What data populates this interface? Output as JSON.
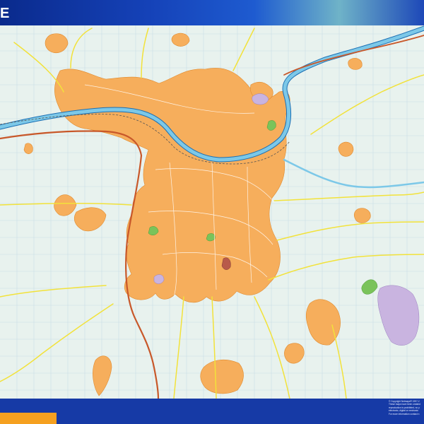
{
  "header": {
    "title": "E"
  },
  "map": {
    "colors": {
      "background": "#e8f2ee",
      "urban": "#f6ae5c",
      "urban_edge": "#e08a2e",
      "water": "#7cc8e8",
      "water_edge": "#1b6fb3",
      "major_road": "#c8582a",
      "road": "#f2e23a",
      "park": "#7ac35a",
      "industrial": "#c9b4e0",
      "grid": "#c9dde6"
    }
  },
  "footer": {
    "copyright_lines": [
      "© Copyright Netmaps® 1997-2",
      "These maps have been created",
      "reproduction is prohibited, no p",
      "electronic, digital or mechanic",
      "For more information contact n"
    ]
  }
}
